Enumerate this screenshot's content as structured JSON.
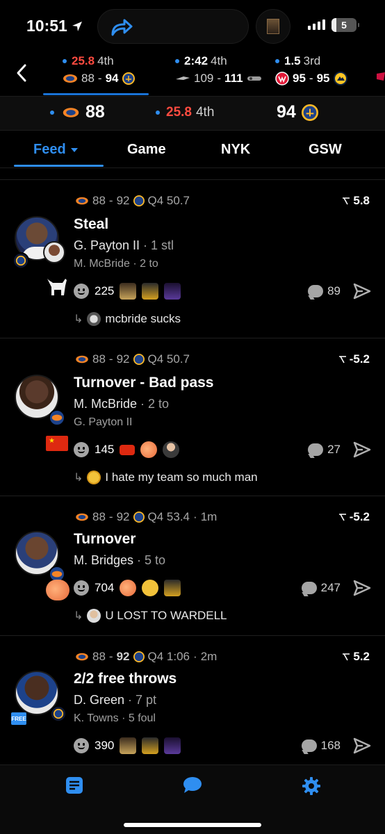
{
  "status_bar": {
    "time": "10:51",
    "battery": "5"
  },
  "games": [
    {
      "clock": "25.8",
      "period": "4th",
      "away_score": "88",
      "home_score": "94",
      "home_bold": true,
      "clock_red": true
    },
    {
      "clock": "2:42",
      "period": "4th",
      "away_score": "109",
      "home_score": "111",
      "home_bold": true
    },
    {
      "clock": "1.5",
      "period": "3rd",
      "away_score": "95",
      "home_score": "95",
      "home_bold": false
    }
  ],
  "scorebar": {
    "away_score": "88",
    "clock": "25.8",
    "period": "4th",
    "home_score": "94"
  },
  "tabs": [
    {
      "label": "Feed",
      "active": true
    },
    {
      "label": "Game"
    },
    {
      "label": "NYK"
    },
    {
      "label": "GSW"
    }
  ],
  "feed": [
    {
      "score_away": "88",
      "score_home": "92",
      "clock": "Q4 50.7",
      "ago": "",
      "odds": "5.8",
      "title": "Steal",
      "player": "G. Payton II",
      "stat": "1 stl",
      "second": "M. McBride · 2 to",
      "reactions": "225",
      "comments": "89",
      "reply": "mcbride sucks"
    },
    {
      "score_away": "88",
      "score_home": "92",
      "clock": "Q4 50.7",
      "ago": "",
      "odds": "-5.2",
      "title": "Turnover - Bad pass",
      "player": "M. McBride",
      "stat": "2 to",
      "second": "G. Payton II",
      "reactions": "145",
      "comments": "27",
      "reply": "I hate my team so much man"
    },
    {
      "score_away": "88",
      "score_home": "92",
      "clock": "Q4 53.4",
      "ago": "1m",
      "odds": "-5.2",
      "title": "Turnover",
      "player": "M. Bridges",
      "stat": "5 to",
      "second": "",
      "reactions": "704",
      "comments": "247",
      "reply": "U LOST TO WARDELL"
    },
    {
      "score_away": "88",
      "score_home": "92",
      "clock": "Q4 1:06",
      "ago": "2m",
      "odds": "5.2",
      "title": "2/2 free throws",
      "player": "D. Green",
      "stat": "7 pt",
      "second": "K. Towns · 5 foul",
      "reactions": "390",
      "comments": "168",
      "reply": ""
    }
  ],
  "badges": {
    "free": "FREE"
  },
  "colors": {
    "accent": "#2f8ef0",
    "live_red": "#ff4b40",
    "knicks_orange": "#f58426",
    "warriors_gold": "#fdb927",
    "warriors_blue": "#1d428a"
  }
}
